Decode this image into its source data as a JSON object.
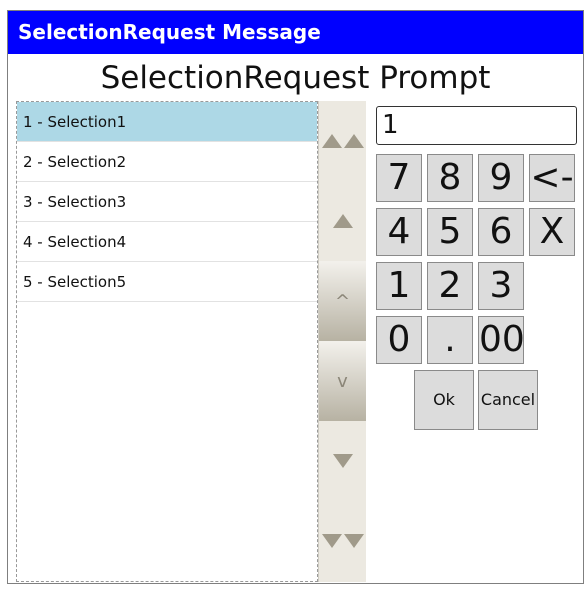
{
  "window": {
    "title": "SelectionRequest Message"
  },
  "prompt": "SelectionRequest Prompt",
  "list": {
    "items": [
      {
        "label": "1 - Selection1",
        "selected": true
      },
      {
        "label": "2 - Selection2",
        "selected": false
      },
      {
        "label": "3 - Selection3",
        "selected": false
      },
      {
        "label": "4 - Selection4",
        "selected": false
      },
      {
        "label": "5 - Selection5",
        "selected": false
      }
    ]
  },
  "scrollbar": {
    "thumb_up_glyph": "^",
    "thumb_down_glyph": "v"
  },
  "keypad": {
    "value": "1",
    "keys": [
      "7",
      "8",
      "9",
      "<-",
      "4",
      "5",
      "6",
      "X",
      "1",
      "2",
      "3",
      "0",
      ".",
      "00"
    ],
    "ok_label": "Ok",
    "cancel_label": "Cancel"
  },
  "colors": {
    "titlebar": "#0000ff",
    "selected_row": "#add8e6",
    "key_bg": "#dcdcdc"
  }
}
